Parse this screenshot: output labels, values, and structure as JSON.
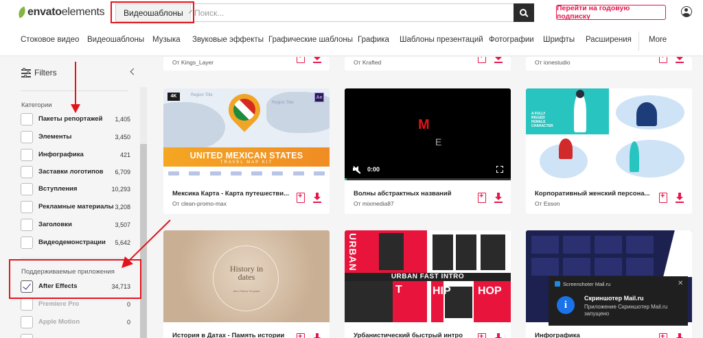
{
  "logo": {
    "brand_bold": "envato",
    "brand_light": "elements"
  },
  "search": {
    "category": "Видеошаблоны",
    "placeholder": "Поиск..."
  },
  "header": {
    "subscribe_label": "Перейти на годовую подписку"
  },
  "nav": [
    "Стоковое видео",
    "Видеошаблоны",
    "Музыка",
    "Звуковые эффекты",
    "Графические шаблоны",
    "Графика",
    "Шаблоны презентаций",
    "Фотографии",
    "Шрифты",
    "Расширения",
    "More"
  ],
  "sidebar": {
    "title": "Filters",
    "categories_title": "Категории",
    "categories": [
      {
        "label": "Пакеты репортажей",
        "count": "1,405"
      },
      {
        "label": "Элементы",
        "count": "3,450"
      },
      {
        "label": "Инфографика",
        "count": "421"
      },
      {
        "label": "Заставки логотипов",
        "count": "6,709"
      },
      {
        "label": "Вступления",
        "count": "10,293"
      },
      {
        "label": "Рекламные материалы",
        "count": "3,208"
      },
      {
        "label": "Заголовки",
        "count": "3,507"
      },
      {
        "label": "Видеодемонстрации",
        "count": "5,642"
      }
    ],
    "apps_title": "Поддерживаемые приложения",
    "apps": [
      {
        "label": "After Effects",
        "count": "34,713",
        "checked": true
      },
      {
        "label": "Premiere Pro",
        "count": "0",
        "checked": false
      },
      {
        "label": "Apple Motion",
        "count": "0",
        "checked": false
      }
    ]
  },
  "top_row_authors": [
    "От Kings_Layer",
    "От Krafted",
    "От ionestudio"
  ],
  "cards": [
    {
      "title": "Мексика Карта - Карта путешестви...",
      "author": "От clean-promo-max",
      "thumb": {
        "badge_4k": "4K",
        "badge_ae": "Ae",
        "region_title": "Region Title",
        "banner": "UNITED MEXICAN STATES",
        "sub": "TRAVEL MAP KIT"
      }
    },
    {
      "title": "Волны абстрактных названий",
      "author": "От mixmedia87",
      "thumb": {
        "logo": "M",
        "letter": "E",
        "time": "0:00"
      }
    },
    {
      "title": "Корпоративный женский персона...",
      "author": "От Esson",
      "thumb": {
        "caption": "A FULLY RIGGED FEMALE CHARACTER"
      }
    },
    {
      "title": "История в Датах - Память истории",
      "author": "",
      "thumb": {
        "headline": "History in dates",
        "sub": "After Effects Template"
      }
    },
    {
      "title": "Урбанистический быстрый интро",
      "author": "",
      "thumb": {
        "bar": "URBAN FAST INTRO",
        "word_left": "T",
        "word_right1": "HIP",
        "word_right2": "HOP",
        "vertical": "URBAN"
      }
    },
    {
      "title": "Инфографика",
      "author": "",
      "thumb": {}
    }
  ],
  "notification": {
    "app": "Screenshoter Mail.ru",
    "title": "Скриншотер Mail.ru",
    "body": "Приложение Скриншотер Mail.ru запущено"
  },
  "colors": {
    "accent": "#e6164a",
    "annotation": "#e3131b",
    "envato_green": "#82b541"
  }
}
